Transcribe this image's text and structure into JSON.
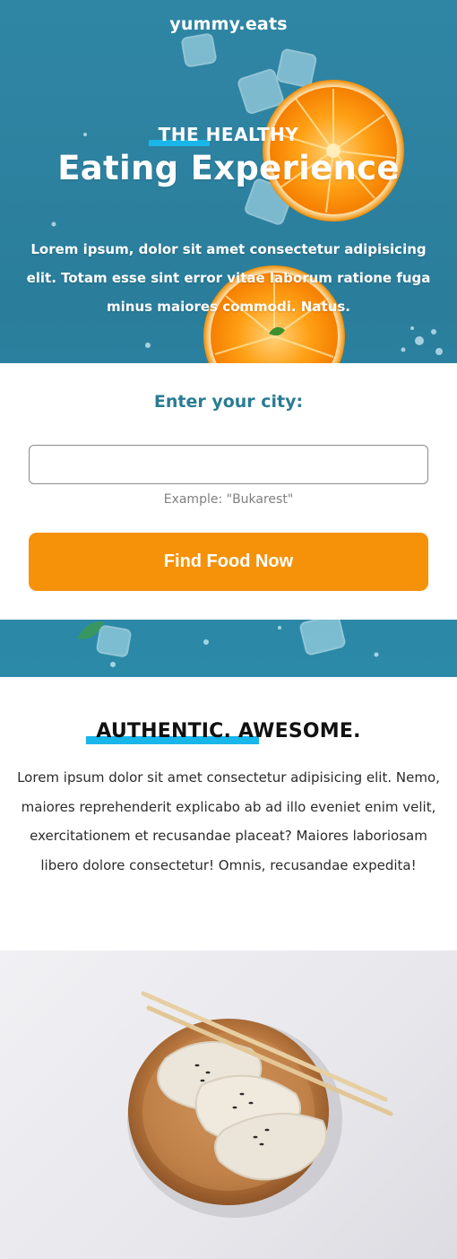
{
  "brand": {
    "name": "yummy.eats"
  },
  "hero": {
    "eyebrow": "THE HEALTHY",
    "headline": "Eating Experience",
    "lead": "Lorem ipsum, dolor sit amet consectetur adipisicing elit. Totam esse sint error vitae laborum ratione fuga minus maiores commodi. Natus."
  },
  "city_form": {
    "title": "Enter your city:",
    "input_value": "",
    "hint": "Example: \"Bukarest\"",
    "submit_label": "Find Food Now"
  },
  "about": {
    "title": "AUTHENTIC. AWESOME.",
    "text": "Lorem ipsum dolor sit amet consectetur adipisicing elit. Nemo, maiores reprehenderit explicabo ab ad illo eveniet enim velit, exercitationem et recusandae placeat? Maiores laboriosam libero dolore consectetur! Omnis, recusandae expedita!"
  },
  "colors": {
    "accent": "#19b6ea",
    "cta": "#f5920a",
    "hero_blue": "#2b8aa8",
    "form_title": "#2a7c93"
  },
  "images": {
    "hero": "oranges-and-ice-on-blue-background",
    "dumplings": "dumplings-on-wooden-plate-with-chopsticks"
  }
}
